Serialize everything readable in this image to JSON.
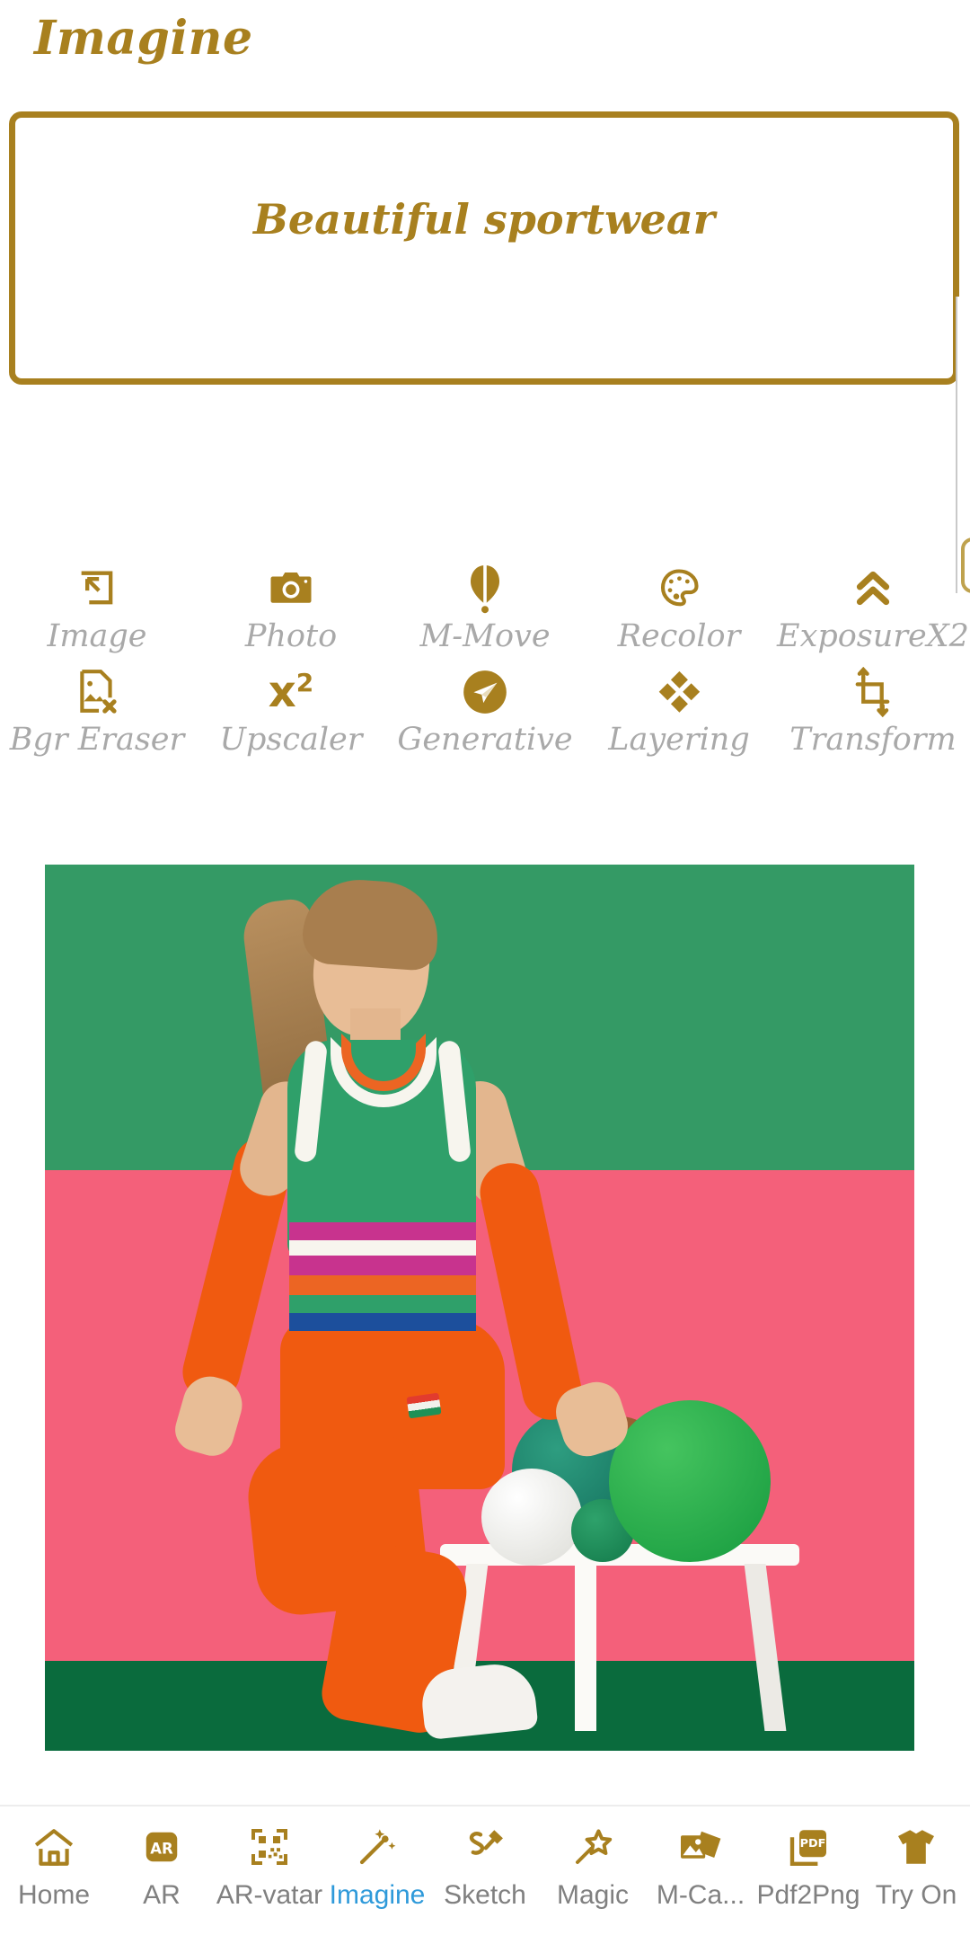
{
  "header": {
    "app_title": "Imagine"
  },
  "prompt": {
    "value": "Beautiful sportwear",
    "placeholder": "Beautiful sportwear"
  },
  "colors": {
    "gold": "#a8801f",
    "label_gray": "#a9a9a9",
    "active_blue": "#2f9ada",
    "nav_gray": "#808080"
  },
  "tools": {
    "row1": [
      {
        "label": "Image",
        "icon": "image-import-icon"
      },
      {
        "label": "Photo",
        "icon": "camera-icon"
      },
      {
        "label": "M-Move",
        "icon": "balloon-icon"
      },
      {
        "label": "Recolor",
        "icon": "palette-icon"
      },
      {
        "label": "ExposureX2",
        "icon": "double-chevron-up-icon"
      }
    ],
    "row2": [
      {
        "label": "Bgr Eraser",
        "icon": "document-image-remove-icon"
      },
      {
        "label": "Upscaler",
        "icon": "x-squared-icon",
        "glyph": "x",
        "exponent": "2"
      },
      {
        "label": "Generative",
        "icon": "paper-plane-circle-icon"
      },
      {
        "label": "Layering",
        "icon": "four-diamonds-icon"
      },
      {
        "label": "Transform",
        "icon": "crop-transform-icon"
      }
    ]
  },
  "generated_image": {
    "alt": "Woman in green and orange sportwear sitting on white stool with green balls",
    "palette": {
      "background_green": "#349a65",
      "background_pink": "#f4607a",
      "floor_green": "#0a6b3d",
      "top_green": "#2fa06a",
      "pants_orange": "#f05a10",
      "stripe_magenta": "#c8338e",
      "stripe_blue": "#1c4f9c",
      "stripe_white": "#f7f5ee"
    }
  },
  "bottom_nav": {
    "items": [
      {
        "label": "Home",
        "icon": "house-icon",
        "active": false
      },
      {
        "label": "AR",
        "icon": "ar-badge-icon",
        "active": false
      },
      {
        "label": "AR-vatar",
        "icon": "qr-code-icon",
        "active": false
      },
      {
        "label": "Imagine",
        "icon": "magic-wand-sparkle-icon",
        "active": true
      },
      {
        "label": "Sketch",
        "icon": "pencil-sketch-icon",
        "active": false
      },
      {
        "label": "Magic",
        "icon": "star-wand-icon",
        "active": false
      },
      {
        "label": "M-Ca...",
        "icon": "photos-stack-icon",
        "active": false
      },
      {
        "label": "Pdf2Png",
        "icon": "pdf-file-icon",
        "active": false
      },
      {
        "label": "Try On",
        "icon": "tshirt-icon",
        "active": false
      }
    ]
  }
}
